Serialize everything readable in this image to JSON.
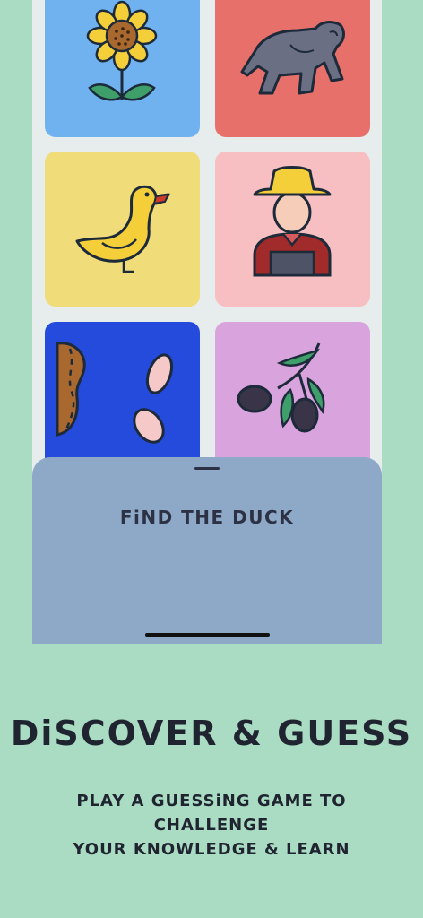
{
  "tiles": [
    {
      "name": "sunflower",
      "icon": "sunflower-icon",
      "background": "#6fb2ef"
    },
    {
      "name": "gorilla",
      "icon": "gorilla-icon",
      "background": "#e8706a"
    },
    {
      "name": "duck",
      "icon": "duck-icon",
      "background": "#f0dc78"
    },
    {
      "name": "farmer",
      "icon": "farmer-icon",
      "background": "#f8bfc2"
    },
    {
      "name": "peanut",
      "icon": "peanut-icon",
      "background": "#244bdc"
    },
    {
      "name": "olive",
      "icon": "olive-branch-icon",
      "background": "#d9a3dd"
    }
  ],
  "sheet": {
    "prompt": "FiND THE DUCK"
  },
  "promo": {
    "headline": "DiSCOVER & GUESS",
    "subline_1": "PLAY A GUESSiNG GAME TO CHALLENGE",
    "subline_2": "YOUR KNOWLEDGE & LEARN"
  },
  "colors": {
    "page_background": "#a9dcc2",
    "sheet_background": "#8ea9c8",
    "text": "#1f2430"
  }
}
